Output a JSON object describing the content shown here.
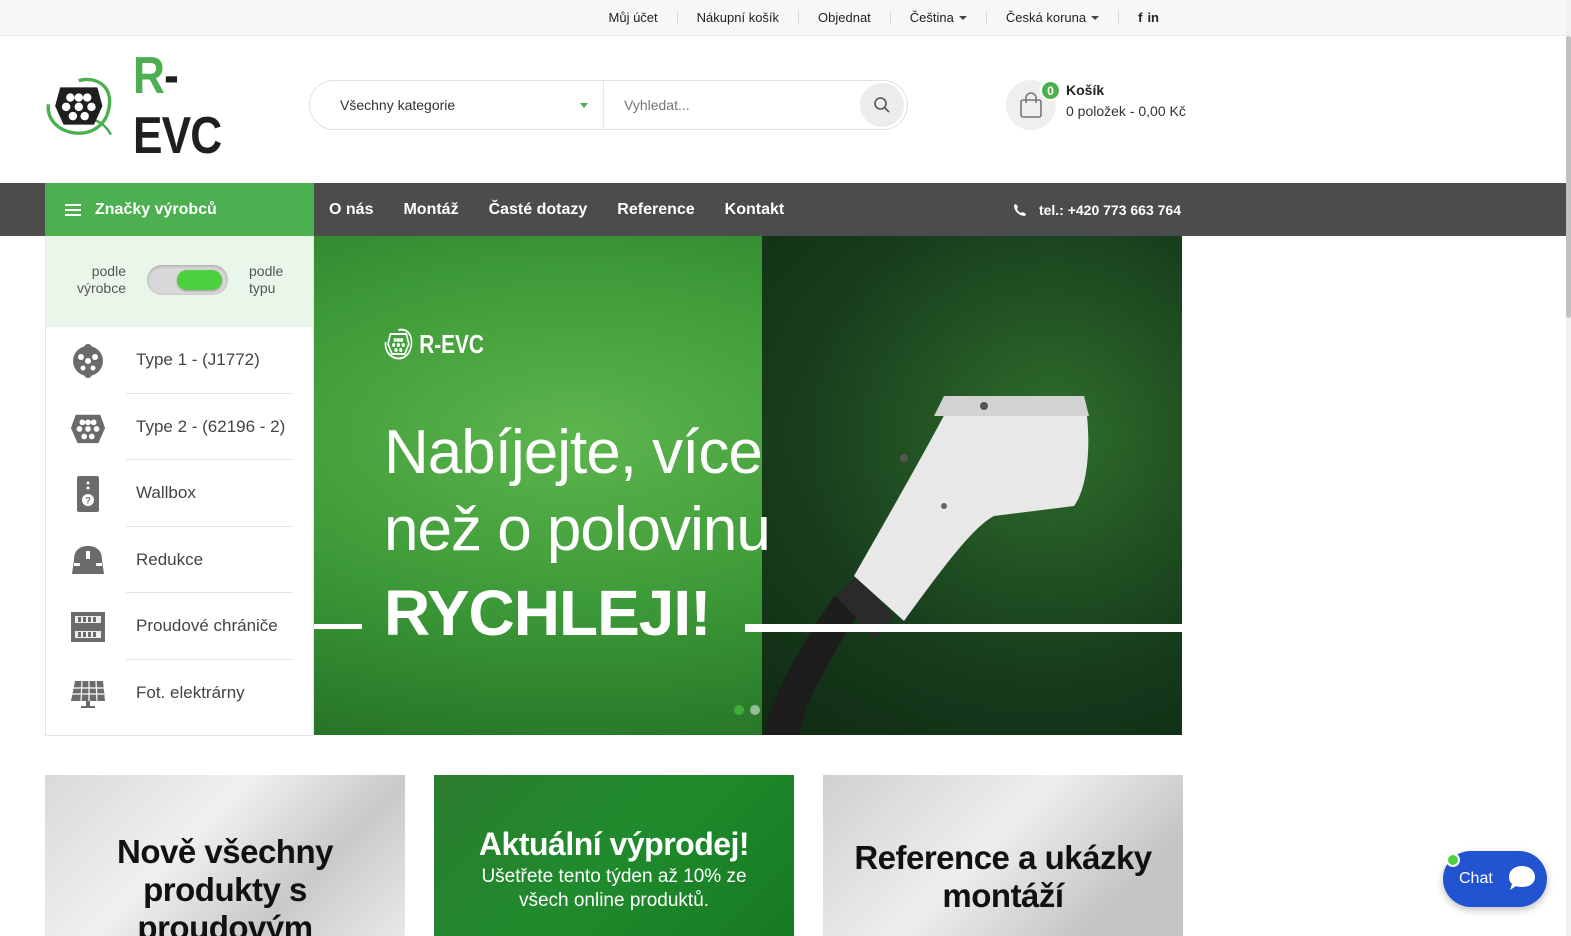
{
  "topbar": {
    "links": [
      "Můj účet",
      "Nákupní košík",
      "Objednat"
    ],
    "language": "Čeština",
    "currency": "Česká koruna",
    "social": [
      "f",
      "in"
    ]
  },
  "header": {
    "logo_text": "R-EVC",
    "logo_prefix": "R",
    "logo_suffix": "-EVC",
    "search": {
      "category": "Všechny kategorie",
      "placeholder": "Vyhledat..."
    },
    "cart": {
      "count": "0",
      "title": "Košík",
      "summary": "0 položek - 0,00 Kč"
    }
  },
  "nav": {
    "brands_label": "Značky výrobců",
    "menu": [
      "O nás",
      "Montáž",
      "Časté dotazy",
      "Reference",
      "Kontakt"
    ],
    "phone": "tel.: +420 773 663 764"
  },
  "sidebar": {
    "toggle_left": "podle výrobce",
    "toggle_right": "podle typu",
    "categories": [
      {
        "label": "Type 1 - (J1772)",
        "icon": "type1-connector-icon"
      },
      {
        "label": "Type 2 - (62196 - 2)",
        "icon": "type2-connector-icon"
      },
      {
        "label": "Wallbox",
        "icon": "wallbox-icon"
      },
      {
        "label": "Redukce",
        "icon": "adapter-icon"
      },
      {
        "label": "Proudové chrániče",
        "icon": "circuit-breaker-icon"
      },
      {
        "label": "Fot. elektrárny",
        "icon": "solar-panel-icon"
      }
    ]
  },
  "banner": {
    "logo_text": "R-EVC",
    "headline_line1": "Nabíjejte, více",
    "headline_line2": "než o polovinu",
    "headline_bold": "RYCHLEJI!",
    "slides": 2,
    "active_slide": 1
  },
  "promos": [
    {
      "title": "Nově všechny produkty s proudovým"
    },
    {
      "title": "Aktuální výprodej!",
      "subtitle": "Ušetřete tento týden až 10% ze všech online produktů."
    },
    {
      "title": "Reference a ukázky montáží"
    }
  ],
  "chat": {
    "label": "Chat"
  },
  "colors": {
    "accent": "#4caf50",
    "nav": "#4c4c4c",
    "chat": "#2253d0"
  }
}
